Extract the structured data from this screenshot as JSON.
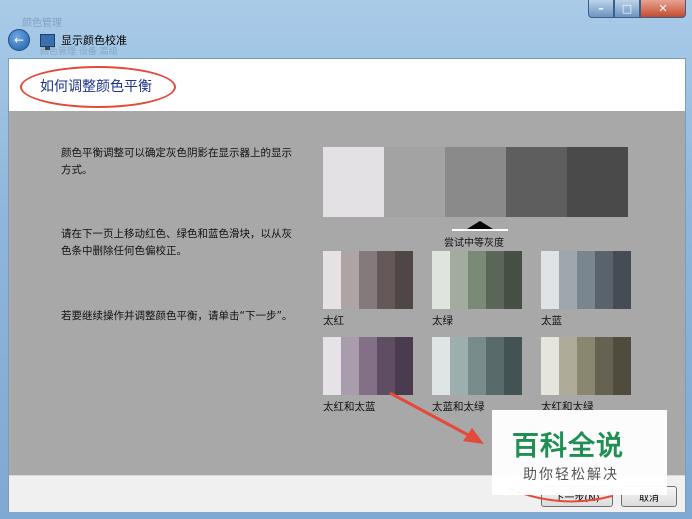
{
  "window": {
    "title": "显示颜色校准",
    "ghost_title": "颜色管理",
    "ghost_toolbar": "颜色管理 设备 高级",
    "caption": {
      "minimize": "–",
      "maximize": "□",
      "close": "✕"
    }
  },
  "nav": {
    "back_icon": "back-arrow-icon"
  },
  "page": {
    "heading": "如何调整颜色平衡",
    "instructions": [
      "颜色平衡调整可以确定灰色阴影在显示器上的显示方式。",
      "请在下一页上移动红色、绿色和蓝色滑块，以从灰色条中删除任何色偏校正。",
      "若要继续操作并调整颜色平衡，请单击“下一步”。"
    ],
    "neutral_bar_colors": [
      "#e3e1e4",
      "#a3a3a3",
      "#8a8a8a",
      "#5e5e5e",
      "#4a4a4a"
    ],
    "neutral_label": "尝试中等灰度",
    "examples": [
      {
        "label": "太红",
        "colors": [
          "#e6e2e3",
          "#aea4a4",
          "#857a7b",
          "#645858",
          "#4f4646"
        ]
      },
      {
        "label": "太绿",
        "colors": [
          "#e0e4df",
          "#a1ab9e",
          "#7b8977",
          "#5a6758",
          "#454f44"
        ]
      },
      {
        "label": "太蓝",
        "colors": [
          "#e0e3e6",
          "#9ea7ae",
          "#7a868f",
          "#5a636c",
          "#454c54"
        ]
      },
      {
        "label": "太红和太蓝",
        "colors": [
          "#e6e2e7",
          "#a99cac",
          "#836f86",
          "#5f4d63",
          "#4a3b4e"
        ]
      },
      {
        "label": "太蓝和太绿",
        "colors": [
          "#dfe5e5",
          "#9daeae",
          "#788c8c",
          "#586a69",
          "#435252"
        ]
      },
      {
        "label": "太红和太绿",
        "colors": [
          "#e6e5dd",
          "#aeab98",
          "#8a8670",
          "#666251",
          "#4f4c3e"
        ]
      }
    ]
  },
  "footer": {
    "next_label": "下一步(N)",
    "cancel_label": "取消"
  },
  "watermark": {
    "brand": "百科全说",
    "slogan": "助你轻松解决"
  },
  "accent_colors": {
    "annotation": "#e34a3a",
    "heading": "#1e3287",
    "watermark": "#1f8f53"
  }
}
